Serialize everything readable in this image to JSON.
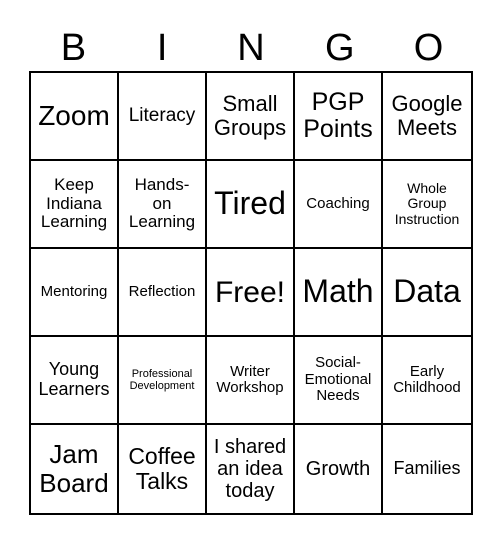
{
  "header": [
    "B",
    "I",
    "N",
    "G",
    "O"
  ],
  "cells": [
    {
      "text": "Zoom",
      "size": 28
    },
    {
      "text": "Literacy",
      "size": 19
    },
    {
      "text": "Small\nGroups",
      "size": 22
    },
    {
      "text": "PGP\nPoints",
      "size": 25
    },
    {
      "text": "Google\nMeets",
      "size": 22
    },
    {
      "text": "Keep\nIndiana\nLearning",
      "size": 17
    },
    {
      "text": "Hands-\non\nLearning",
      "size": 17
    },
    {
      "text": "Tired",
      "size": 32
    },
    {
      "text": "Coaching",
      "size": 15
    },
    {
      "text": "Whole\nGroup\nInstruction",
      "size": 14
    },
    {
      "text": "Mentoring",
      "size": 15
    },
    {
      "text": "Reflection",
      "size": 15
    },
    {
      "text": "Free!",
      "size": 30
    },
    {
      "text": "Math",
      "size": 32
    },
    {
      "text": "Data",
      "size": 32
    },
    {
      "text": "Young\nLearners",
      "size": 18
    },
    {
      "text": "Professional\nDevelopment",
      "size": 11
    },
    {
      "text": "Writer\nWorkshop",
      "size": 15
    },
    {
      "text": "Social-\nEmotional\nNeeds",
      "size": 15
    },
    {
      "text": "Early\nChildhood",
      "size": 15
    },
    {
      "text": "Jam\nBoard",
      "size": 26
    },
    {
      "text": "Coffee\nTalks",
      "size": 23
    },
    {
      "text": "I shared\nan idea\ntoday",
      "size": 20
    },
    {
      "text": "Growth",
      "size": 20
    },
    {
      "text": "Families",
      "size": 18
    }
  ]
}
